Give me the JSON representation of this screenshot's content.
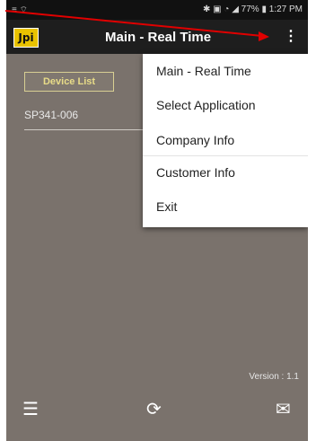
{
  "status_bar": {
    "left_icons": "≡ ⌔",
    "right_text": "✱ ▣ ◔ ◢ 77% ▮ 1:27 PM"
  },
  "app_bar": {
    "logo_text": "Jpi",
    "title": "Main - Real Time",
    "overflow_glyph": "⋮"
  },
  "device_list": {
    "button_label": "Device List",
    "items": [
      "SP341-006"
    ]
  },
  "overflow_menu": {
    "items": [
      "Main - Real Time",
      "Select Application",
      "Company Info",
      "Customer Info",
      "Exit"
    ]
  },
  "footer": {
    "version": "Version : 1.1"
  },
  "bottom_nav": {
    "list_glyph": "☰",
    "refresh_glyph": "⟳",
    "mail_glyph": "✉"
  },
  "colors": {
    "background": "#7a726c",
    "annotation_arrow": "#e00000",
    "logo": "#e8c200"
  }
}
